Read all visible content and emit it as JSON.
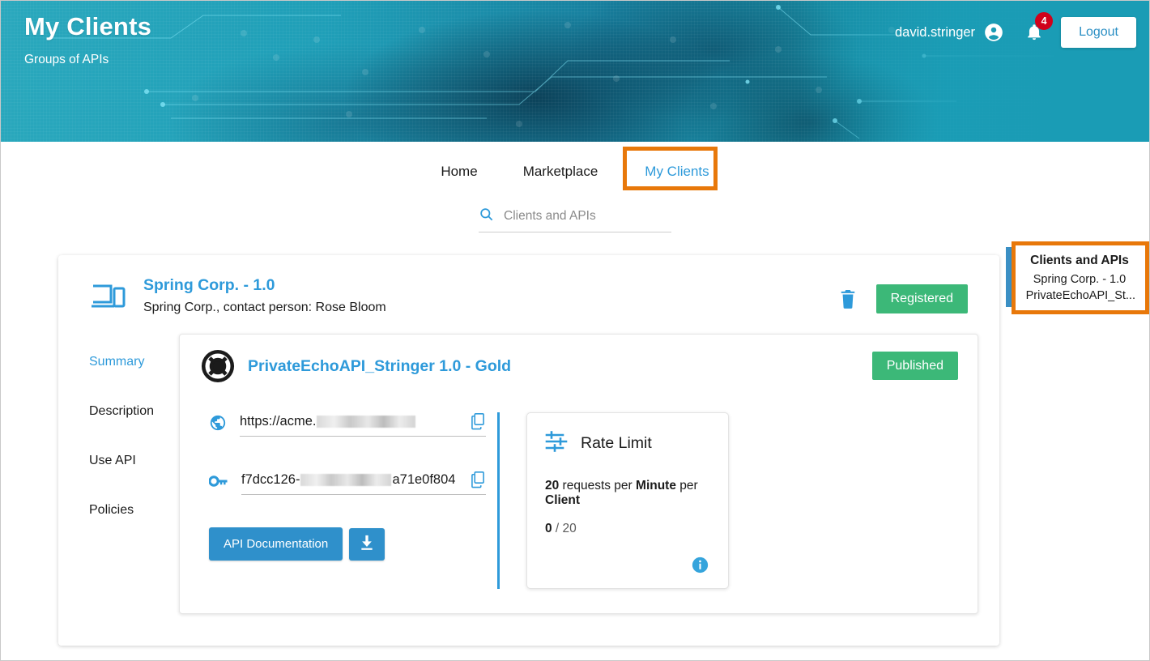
{
  "banner": {
    "title": "My Clients",
    "subtitle": "Groups of APIs",
    "username": "david.stringer",
    "avatar_icon": "account-circle-icon",
    "bell_icon": "notification-bell-icon",
    "bell_count": "4",
    "logout_label": "Logout",
    "teal": "#1a9cb5"
  },
  "nav": {
    "items": [
      {
        "label": "Home",
        "active": false
      },
      {
        "label": "Marketplace",
        "active": false
      },
      {
        "label": "My Clients",
        "active": true
      }
    ],
    "highlight_color": "#e8780a"
  },
  "search": {
    "icon": "search-icon",
    "placeholder": "Clients and APIs",
    "value": ""
  },
  "client": {
    "icon": "devices-icon",
    "name": "Spring Corp. - 1.0",
    "subtitle": "Spring Corp., contact person: Rose Bloom",
    "delete_icon": "trash-icon",
    "status": "Registered",
    "status_color": "#3cb878",
    "tabs": [
      {
        "label": "Summary",
        "active": true
      },
      {
        "label": "Description",
        "active": false
      },
      {
        "label": "Use API",
        "active": false
      },
      {
        "label": "Policies",
        "active": false
      }
    ]
  },
  "api": {
    "icon": "lifebuoy-icon",
    "title": "PrivateEchoAPI_Stringer 1.0 - Gold",
    "status": "Published",
    "status_color": "#3cb878",
    "endpoint": {
      "icon": "globe-icon",
      "prefix": "https://acme.",
      "redacted": true,
      "suffix": "",
      "copy_icon": "copy-icon"
    },
    "apikey": {
      "icon": "key-icon",
      "prefix": "f7dcc126-",
      "redacted": true,
      "suffix": "a71e0f804",
      "copy_icon": "copy-icon"
    },
    "doc_button": "API Documentation",
    "download_icon": "download-icon",
    "primary_color": "#2f90cb"
  },
  "rate_limit": {
    "icon": "tune-sliders-icon",
    "title": "Rate Limit",
    "limit_value": "20",
    "limit_mid": " requests per ",
    "period": "Minute",
    "limit_per": " per ",
    "scope": "Client",
    "used": "0",
    "used_sep": " / ",
    "total": "20",
    "info_icon": "info-icon"
  },
  "callout": {
    "title": "Clients and APIs",
    "line1": "Spring Corp. - 1.0",
    "line2": "PrivateEchoAPI_St...",
    "border_color": "#e8780a"
  }
}
